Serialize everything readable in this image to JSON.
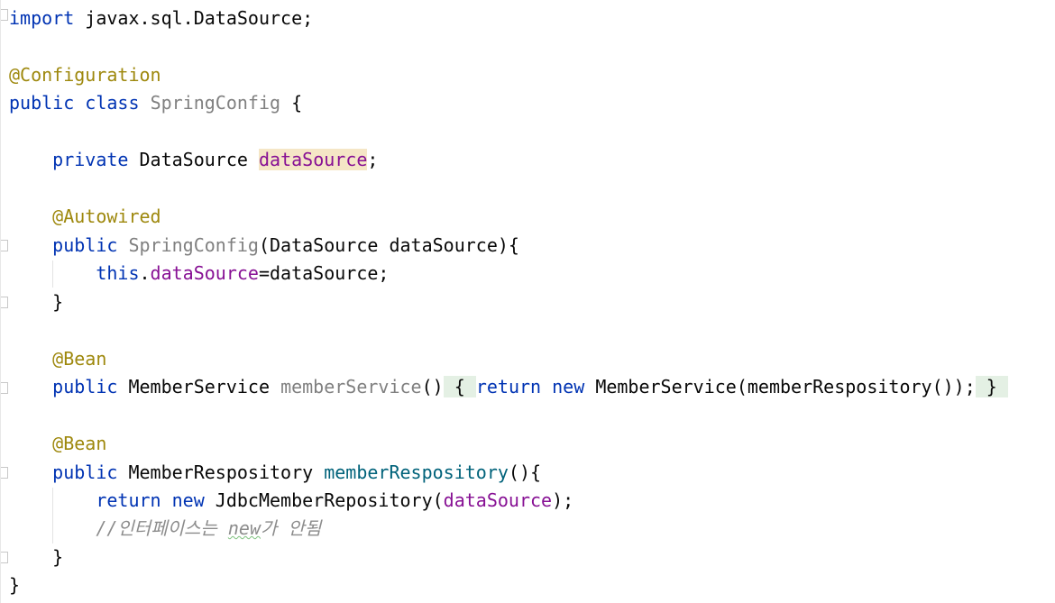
{
  "code": {
    "import_kw": "import",
    "import_rest": " javax.sql.DataSource;",
    "config_ann": "@Configuration",
    "public_kw": "public",
    "class_kw": "class",
    "class_name": "SpringConfig",
    "open_brace": "{",
    "private_kw": "private",
    "datasource_type": "DataSource",
    "datasource_field": "dataSource",
    "semicolon": ";",
    "autowired_ann": "@Autowired",
    "ctor_name": "SpringConfig",
    "ctor_params": "(DataSource dataSource){",
    "this_kw": "this",
    "dot": ".",
    "assign_rest": "=dataSource;",
    "close_brace": "}",
    "bean_ann": "@Bean",
    "member_service_type": "MemberService",
    "member_service_method": "memberService",
    "parens": "()",
    "return_kw": "return",
    "new_kw": "new",
    "member_service_call": "MemberService(memberRespository());",
    "member_repo_type": "MemberRespository",
    "member_repo_method": "memberRespository",
    "method_open": "(){",
    "jdbc_call": "JdbcMemberRepository(",
    "call_close": ");",
    "comment_prefix": "//인터페이스는 ",
    "comment_new": "new",
    "comment_suffix": "가 안됨"
  }
}
